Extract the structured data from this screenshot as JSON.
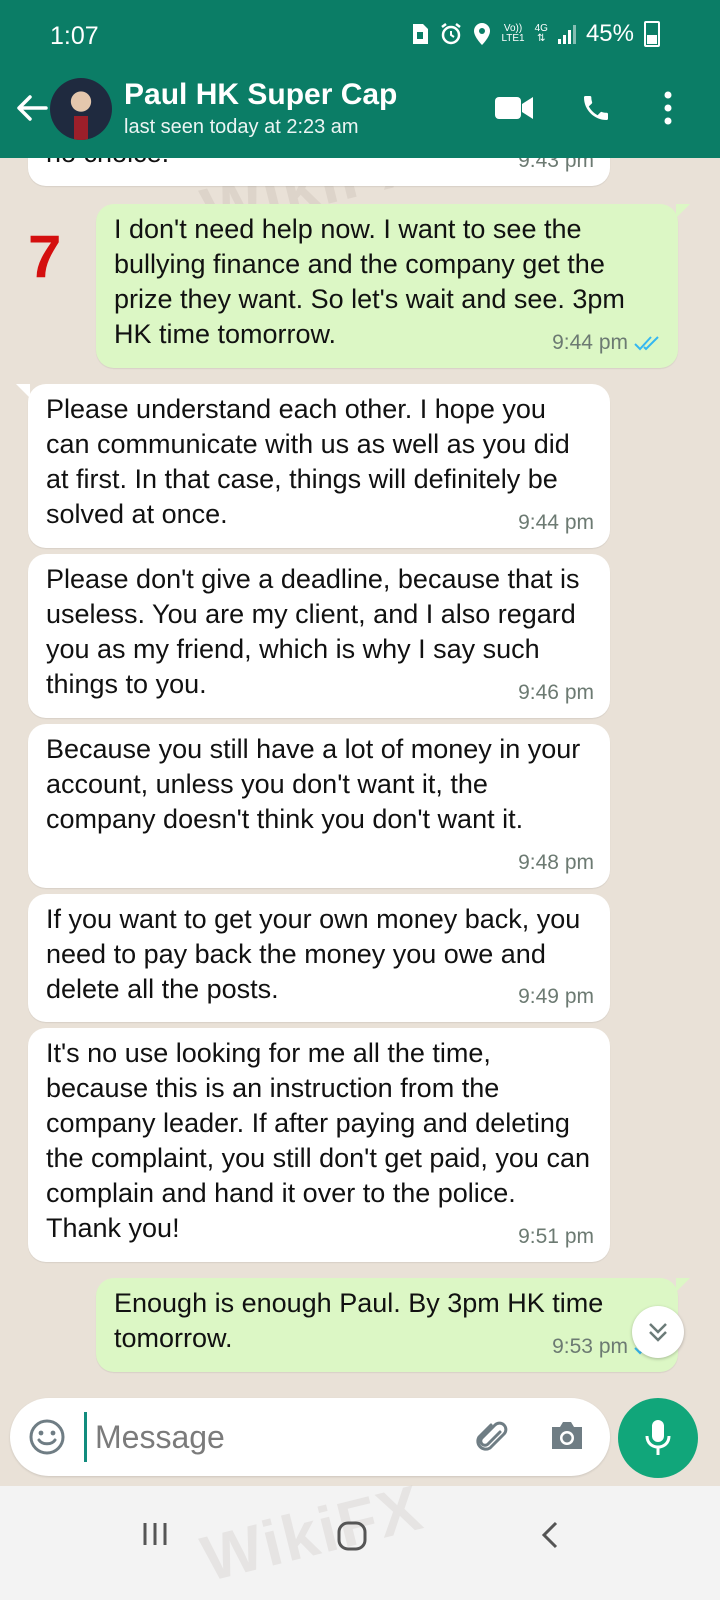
{
  "status_bar": {
    "time": "1:07",
    "volte": "Vo))",
    "lte": "LTE1",
    "network": "4G",
    "battery": "45%"
  },
  "header": {
    "contact_name": "Paul HK Super Cap",
    "last_seen": "last seen today at 2:23 am"
  },
  "annotation": "7",
  "watermark": "WikiFX",
  "messages": [
    {
      "dir": "in",
      "text": "no choice.",
      "time": "9:43 pm"
    },
    {
      "dir": "out",
      "text": "I don't need help now. I want to see the bullying finance and the company get the prize they want. So let's wait and see. 3pm HK time tomorrow.",
      "time": "9:44 pm"
    },
    {
      "dir": "in",
      "text": "Please understand each other. I hope you can communicate with us as well as you did at first. In that case, things will definitely be solved at once.",
      "time": "9:44 pm"
    },
    {
      "dir": "in",
      "text": "Please don't give a deadline, because that is useless. You are my client, and I also regard you as my friend, which is why I say such things to you.",
      "time": "9:46 pm"
    },
    {
      "dir": "in",
      "text": "Because you still have a lot of money in your account, unless you don't want it, the company doesn't think you don't want it.",
      "time": "9:48 pm"
    },
    {
      "dir": "in",
      "text": "If you want to get your own money back, you need to pay back the money you owe and delete all the posts.",
      "time": "9:49 pm"
    },
    {
      "dir": "in",
      "text": "It's no use looking for me all the time, because this is an instruction from the company leader. If after paying and deleting the complaint, you still don't get paid, you can complain and hand it over to the police. Thank you!",
      "time": "9:51 pm"
    },
    {
      "dir": "out",
      "text": "Enough is enough Paul. By 3pm HK time tomorrow.",
      "time": "9:53 pm"
    }
  ],
  "input": {
    "placeholder": "Message"
  },
  "colors": {
    "header": "#0b7d66",
    "outgoing_bubble": "#dcf7c5",
    "incoming_bubble": "#ffffff",
    "read_ticks": "#34b7f1",
    "mic_button": "#11a67a",
    "annotation": "#d40f0f"
  },
  "icons": {
    "header": [
      "back-arrow-icon",
      "video-call-icon",
      "voice-call-icon",
      "more-vert-icon"
    ],
    "input": [
      "emoji-icon",
      "attach-icon",
      "camera-icon",
      "mic-icon"
    ],
    "nav": [
      "recent-apps-icon",
      "home-icon",
      "back-nav-icon"
    ]
  }
}
